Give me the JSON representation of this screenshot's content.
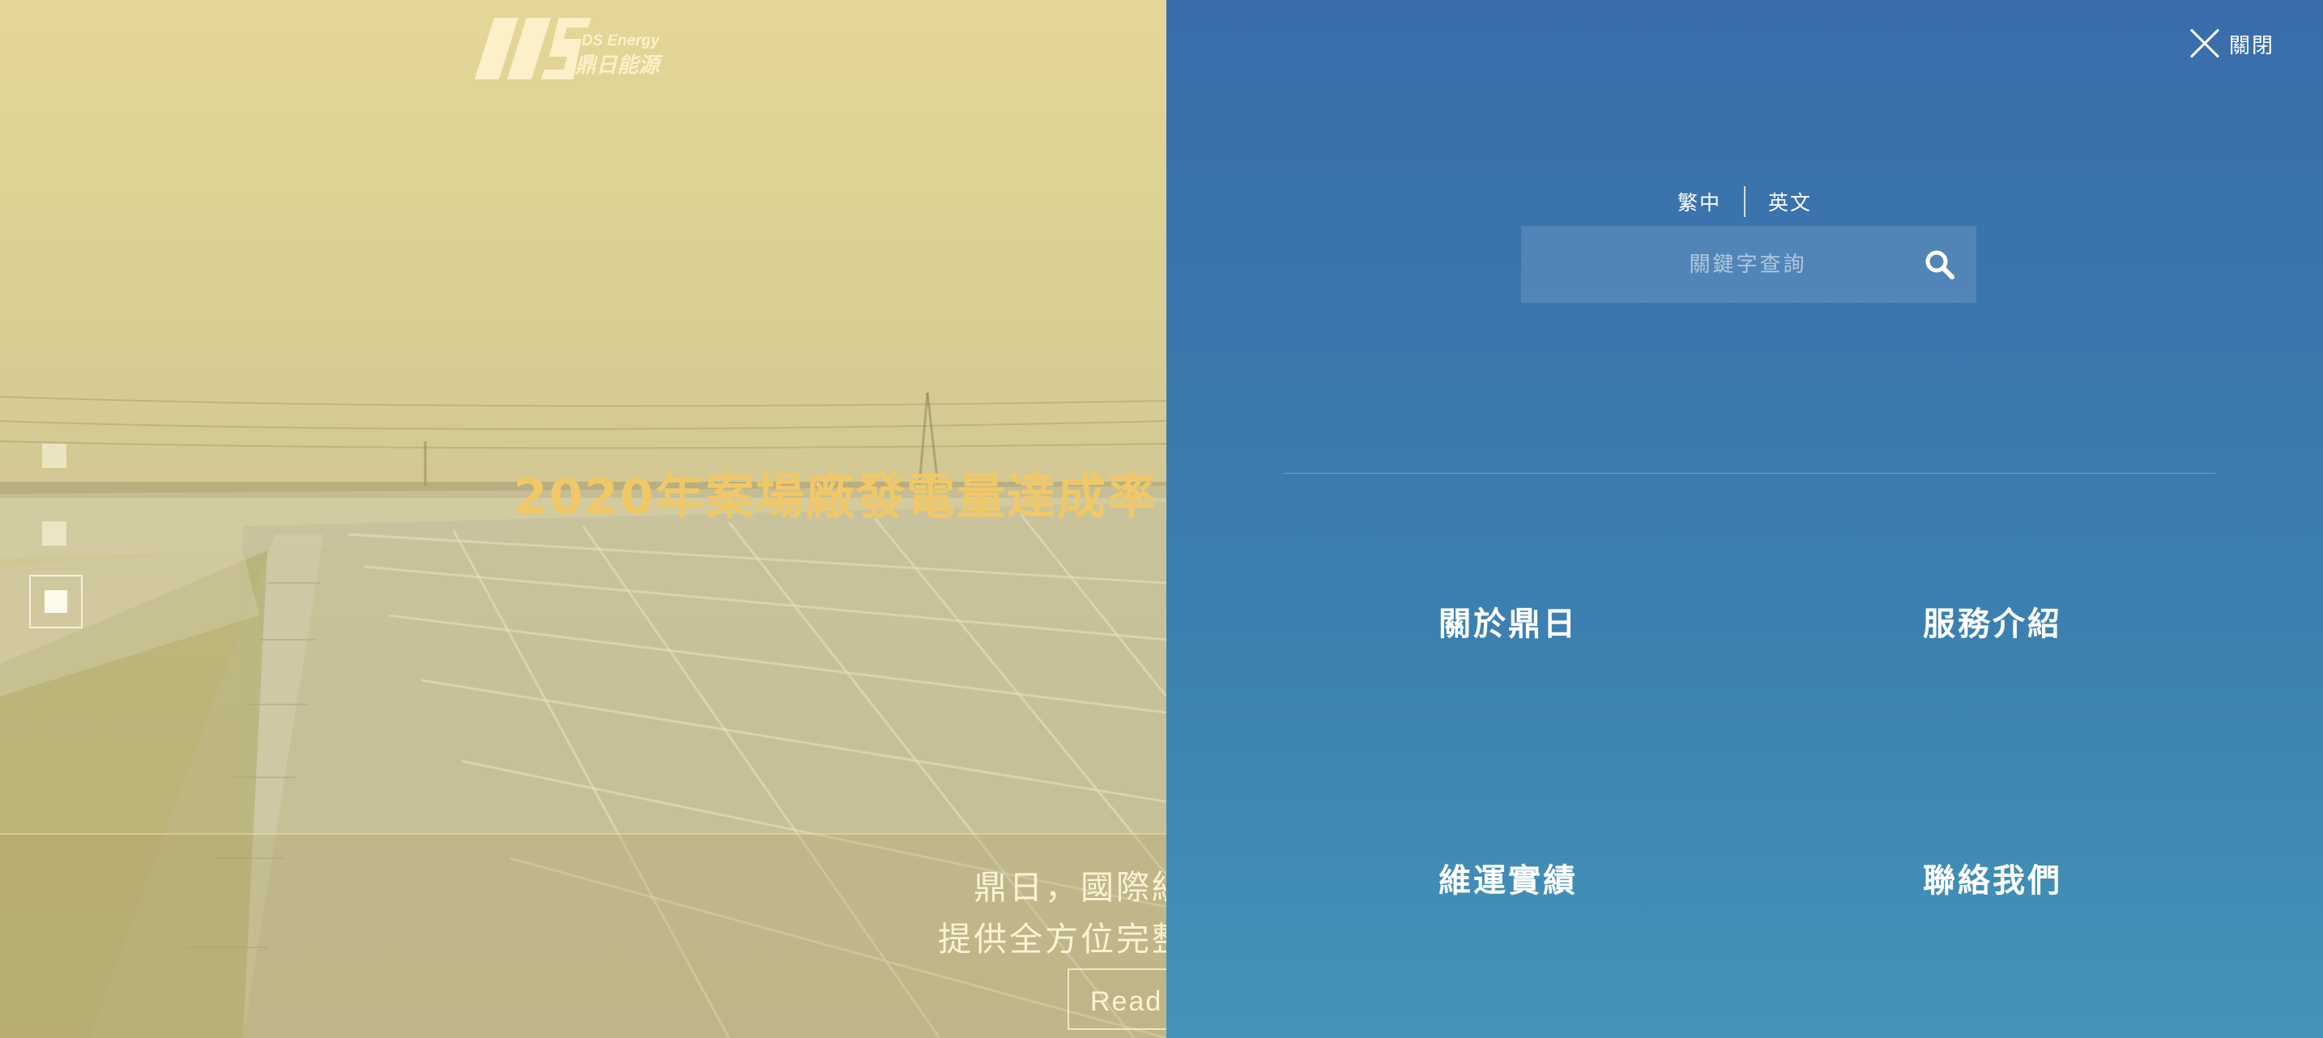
{
  "brand": {
    "logo_text_en": "DS Energy",
    "logo_text_zh": "鼎日能源"
  },
  "hero": {
    "title": "2020年案場廠發電量達成率",
    "desc_line1": "鼎日，國際級專",
    "desc_line2": "提供全方位完整的",
    "read_more_label": "Read",
    "slides": {
      "count": 3,
      "active_index": 3
    }
  },
  "menu": {
    "close_label": "關閉",
    "languages": [
      "繁中",
      "英文"
    ],
    "search": {
      "placeholder": "關鍵字查詢",
      "value": ""
    },
    "items": [
      {
        "label": "關於鼎日"
      },
      {
        "label": "服務介紹"
      },
      {
        "label": "維運實績"
      },
      {
        "label": "聯絡我們"
      }
    ]
  },
  "colors": {
    "panel_top": "#3a6cab",
    "panel_bottom": "#4394b8",
    "hero_title": "#f0c868",
    "hero_tint": "#e1d7a3"
  }
}
